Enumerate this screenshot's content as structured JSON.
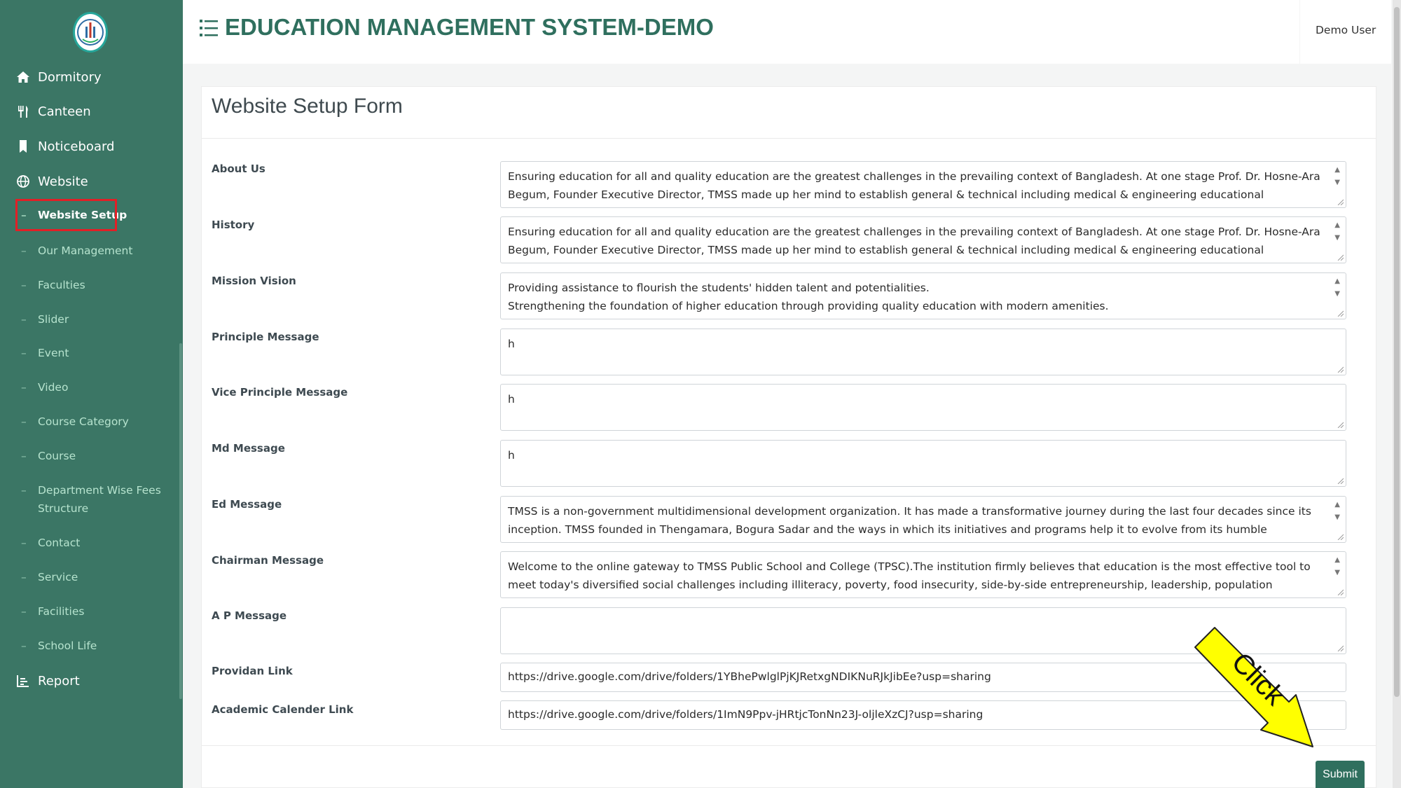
{
  "colors": {
    "sidebar": "#3b7665",
    "brand": "#2f6f5e",
    "active_highlight": "#e21f26",
    "callout": "#ffff00"
  },
  "header": {
    "title": "EDUCATION MANAGEMENT SYSTEM-DEMO",
    "user": "Demo User"
  },
  "sidebar": {
    "items": [
      {
        "label": "Dormitory",
        "icon": "home-icon"
      },
      {
        "label": "Canteen",
        "icon": "utensils-icon"
      },
      {
        "label": "Noticeboard",
        "icon": "bookmark-icon"
      },
      {
        "label": "Website",
        "icon": "globe-icon"
      }
    ],
    "website_submenu": [
      "Website Setup",
      "Our Management",
      "Faculties",
      "Slider",
      "Event",
      "Video",
      "Course Category",
      "Course",
      "Department Wise Fees Structure",
      "Contact",
      "Service",
      "Facilities",
      "School Life"
    ],
    "active_submenu": "Website Setup",
    "report": {
      "label": "Report",
      "icon": "chart-icon"
    }
  },
  "form": {
    "title": "Website Setup Form",
    "fields": [
      {
        "label": "About Us",
        "value": "Ensuring education for all and quality education are the greatest challenges in the prevailing context of Bangladesh. At one stage Prof. Dr. Hosne-Ara Begum, Founder Executive Director, TMSS made up her mind to establish general & technical including medical & engineering educational institutions keeping in view that the emerging"
      },
      {
        "label": "History",
        "value": "Ensuring education for all and quality education are the greatest challenges in the prevailing context of Bangladesh. At one stage Prof. Dr. Hosne-Ara Begum, Founder Executive Director, TMSS made up her mind to establish general & technical including medical & engineering educational institutions keeping in view that the emerging"
      },
      {
        "label": "Mission Vision",
        "value": "Providing assistance to flourish the students' hidden talent and potentialities.\nStrengthening the foundation of higher education through providing quality education with modern amenities."
      },
      {
        "label": "Principle Message",
        "value": "h"
      },
      {
        "label": "Vice Principle Message",
        "value": "h"
      },
      {
        "label": "Md Message",
        "value": "h"
      },
      {
        "label": "Ed Message",
        "value": "TMSS is a non-government multidimensional development organization. It has made a transformative journey during the last four decades since its inception. TMSS founded in Thengamara, Bogura Sadar and the ways in which its initiatives and programs help it to evolve from its humble beginning into one of the largest NGOs in Bangladesh –"
      },
      {
        "label": "Chairman Message",
        "value": "Welcome to the online gateway to TMSS Public School and College (TPSC).The institution firmly believes that education is the most effective tool to meet today's diversified social challenges including illiteracy, poverty, food insecurity, side-by-side entrepreneurship, leadership, population explosion and good governance in the society."
      },
      {
        "label": "A P Message",
        "value": ""
      },
      {
        "label": "Providan Link",
        "value": "https://drive.google.com/drive/folders/1YBhePwlglPjKJRetxgNDIKNuRJkJibEe?usp=sharing"
      },
      {
        "label": "Academic Calender Link",
        "value": "https://drive.google.com/drive/folders/1ImN9Ppv-jHRtjcTonNn23J-oljleXzCJ?usp=sharing"
      }
    ],
    "submit_label": "Submit"
  },
  "annotation": {
    "callout_text": "Click"
  }
}
